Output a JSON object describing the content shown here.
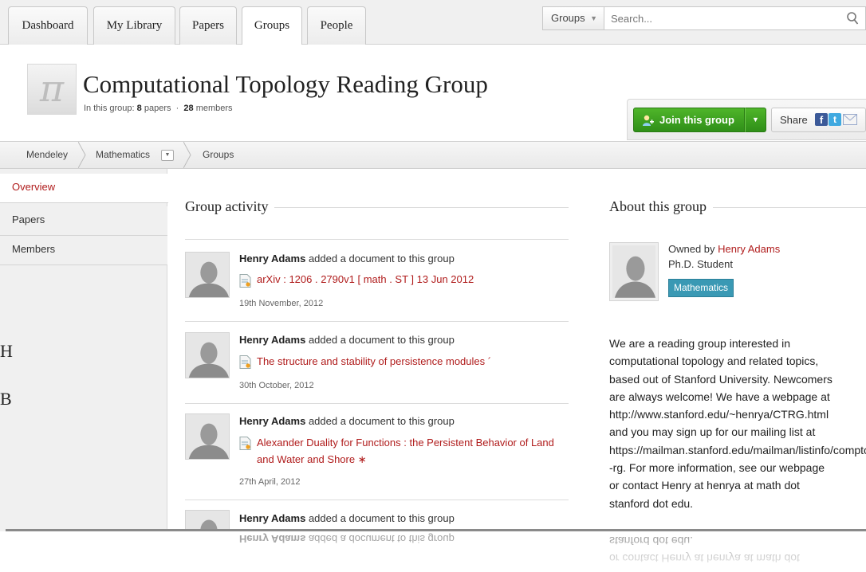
{
  "top_nav": {
    "tabs": [
      "Dashboard",
      "My Library",
      "Papers",
      "Groups",
      "People"
    ],
    "active_tab": "Groups",
    "search_scope": "Groups",
    "search_placeholder": "Search..."
  },
  "group": {
    "logo_glyph": "π",
    "title": "Computational Topology Reading Group",
    "sub_prefix": "In this group:",
    "papers_count": "8",
    "papers_label": "papers",
    "sep": "·",
    "members_count": "28",
    "members_label": "members",
    "join_label": "Join this group",
    "share_label": "Share"
  },
  "breadcrumb": [
    "Mendeley",
    "Mathematics",
    "Groups"
  ],
  "left_nav": {
    "items": [
      "Overview",
      "Papers",
      "Members"
    ],
    "active": "Overview"
  },
  "activity": {
    "heading": "Group activity",
    "items": [
      {
        "user": "Henry Adams",
        "action": "added a document to this group",
        "doc": "arXiv : 1206 . 2790v1 [ math . ST ] 13 Jun 2012",
        "date": "19th November, 2012"
      },
      {
        "user": "Henry Adams",
        "action": "added a document to this group",
        "doc": "The structure and stability of persistence modules ´",
        "date": "30th October, 2012"
      },
      {
        "user": "Henry Adams",
        "action": "added a document to this group",
        "doc_line1": "Alexander Duality for Functions : the Persistent Behavior of Land",
        "doc_line2": "and Water and Shore ∗",
        "date": "27th April, 2012"
      },
      {
        "user": "Henry Adams",
        "action": "added a document to this group"
      }
    ]
  },
  "about": {
    "heading": "About this group",
    "owned_by_prefix": "Owned by",
    "owner": "Henry Adams",
    "owner_role": "Ph.D. Student",
    "tag": "Mathematics",
    "description_lines": [
      "We are a reading group interested in",
      "computational topology and related topics,",
      "based out of Stanford University. Newcomers",
      "are always welcome! We have a webpage at",
      "http://www.stanford.edu/~henrya/CTRG.html",
      "and you may sign up for our mailing list at",
      "https://mailman.stanford.edu/mailman/listinfo/comptop",
      "-rg. For more information, see our webpage",
      "or contact Henry at henrya at math dot",
      "stanford dot edu."
    ]
  },
  "background_letters": [
    "H",
    "B"
  ],
  "colors": {
    "link_red": "#b01c1c",
    "join_green": "#3a9f1e",
    "tag_blue": "#3a99b4"
  }
}
